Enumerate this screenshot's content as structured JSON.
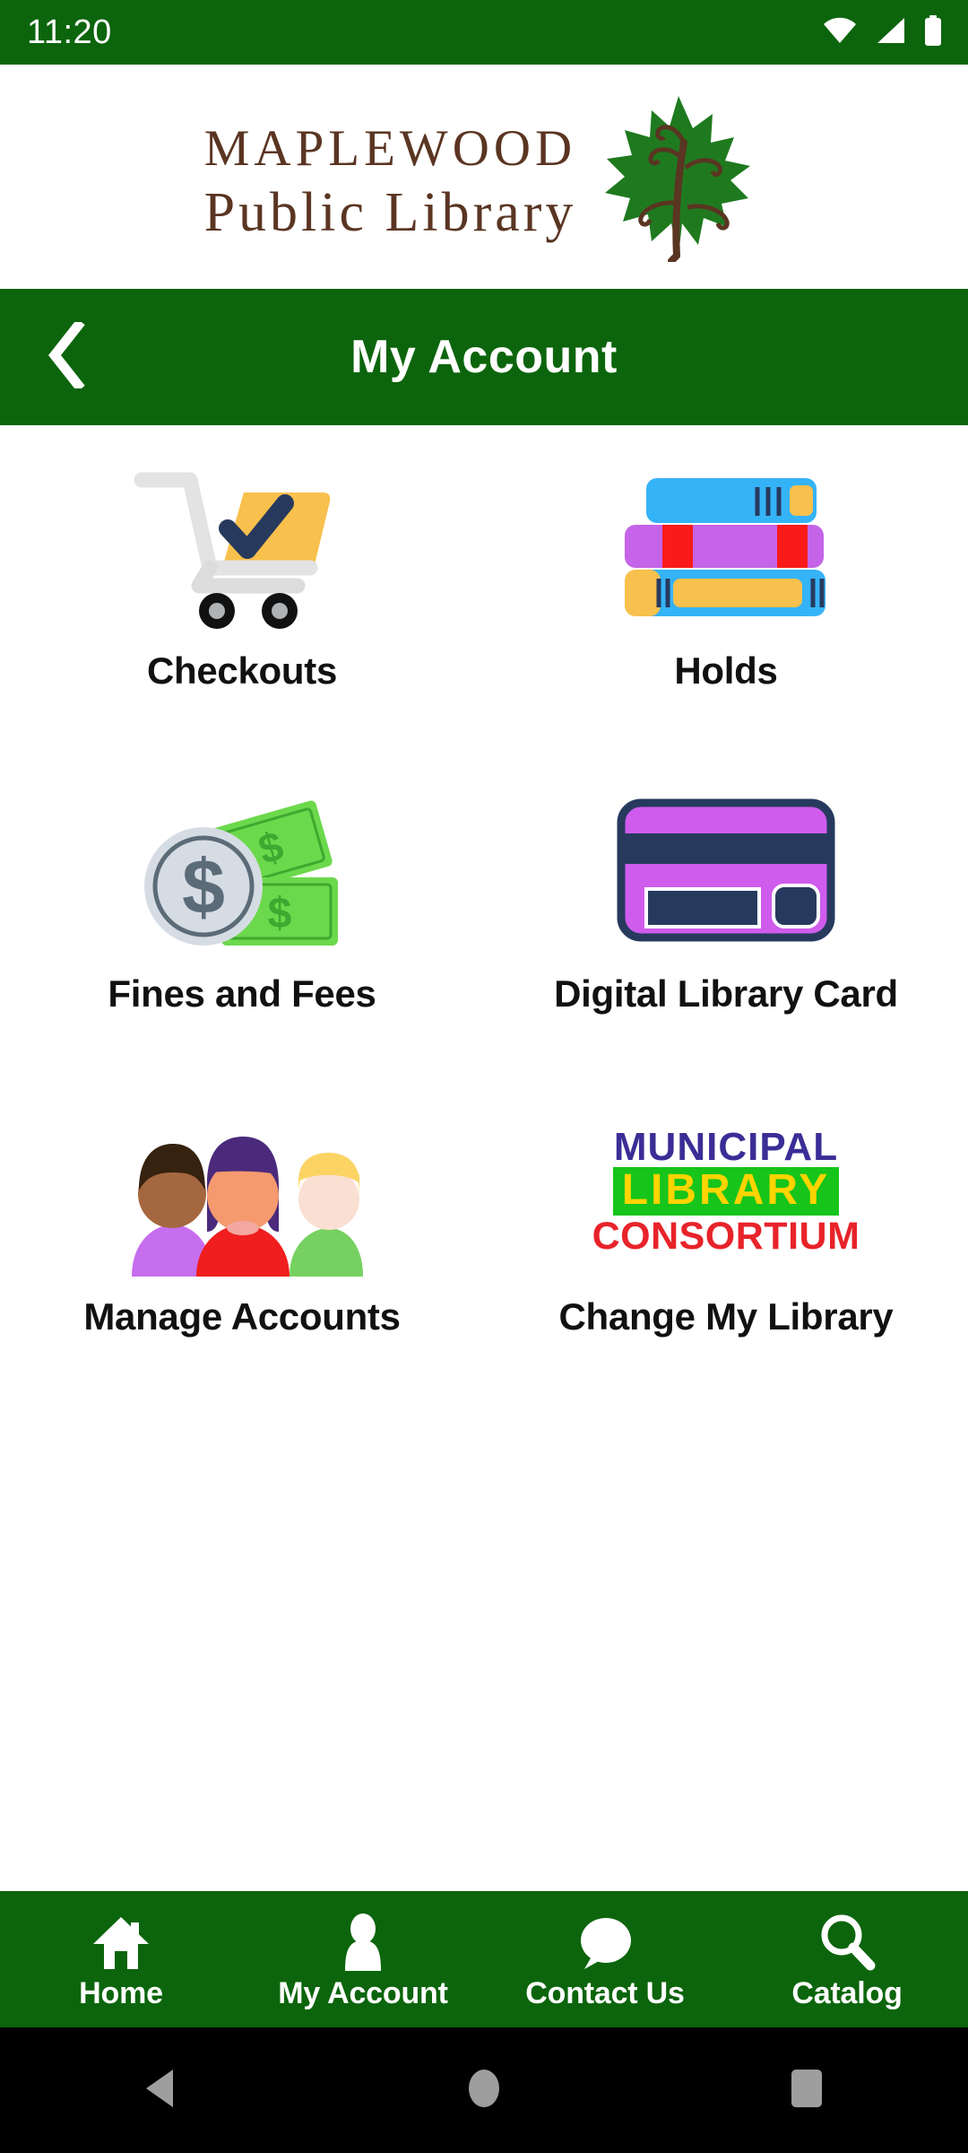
{
  "status_bar": {
    "clock": "11:20",
    "icons": [
      "wifi-icon",
      "cellular-signal-icon",
      "battery-icon"
    ],
    "background": "#0C650C"
  },
  "brand_header": {
    "line1": "Maplewood",
    "line2": "Public Library",
    "logo_icon": "maple-leaf-icon",
    "text_color": "#5a3522",
    "leaf_color": "#1F7A1F"
  },
  "title_bar": {
    "back_icon": "back-chevron-icon",
    "title": "My Account",
    "background": "#0C650C"
  },
  "grid": {
    "tiles": [
      {
        "label": "Checkouts",
        "icon": "shopping-cart-check-icon"
      },
      {
        "label": "Holds",
        "icon": "book-stack-icon"
      },
      {
        "label": "Fines and Fees",
        "icon": "coin-and-cash-icon"
      },
      {
        "label": "Digital Library Card",
        "icon": "library-card-icon"
      },
      {
        "label": "Manage Accounts",
        "icon": "three-people-icon"
      },
      {
        "label": "Change My Library",
        "icon": "municipal-library-consortium-logo"
      }
    ]
  },
  "consortium_logo": {
    "line1": "MUNICIPAL",
    "line2": "LIBRARY",
    "line3": "CONSORTIUM",
    "registered_mark": "®",
    "line1_color": "#3B2D96",
    "line2_color": "#FFD400",
    "line2_background": "#16C41A",
    "line3_color": "#E8232A"
  },
  "tab_bar": {
    "background": "#0C650C",
    "tabs": [
      {
        "label": "Home",
        "icon": "home-icon"
      },
      {
        "label": "My Account",
        "icon": "person-icon"
      },
      {
        "label": "Contact Us",
        "icon": "speech-bubble-icon"
      },
      {
        "label": "Catalog",
        "icon": "search-magnifier-icon"
      }
    ]
  },
  "system_nav": {
    "background": "#000000",
    "buttons": [
      {
        "icon": "android-back-triangle-icon"
      },
      {
        "icon": "android-home-circle-icon"
      },
      {
        "icon": "android-recents-square-icon"
      }
    ]
  }
}
